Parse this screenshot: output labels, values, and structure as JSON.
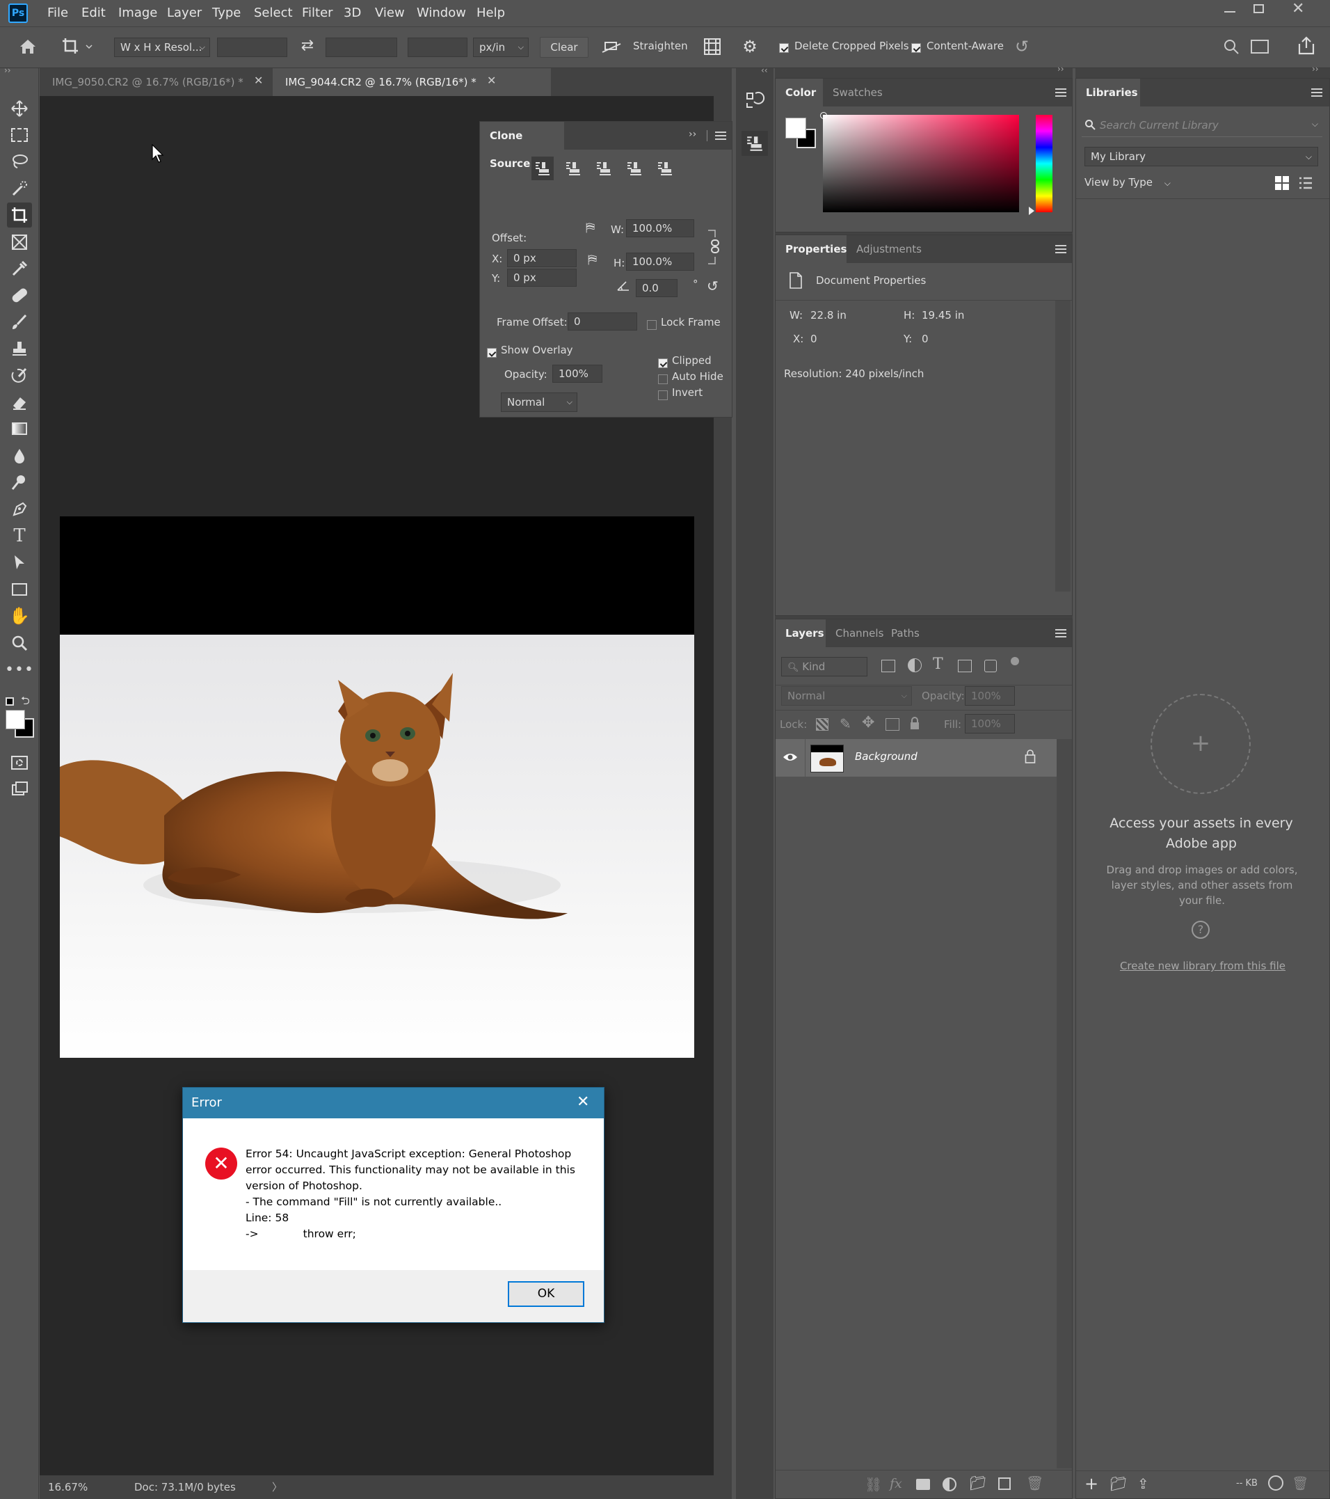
{
  "menu": [
    "File",
    "Edit",
    "Image",
    "Layer",
    "Type",
    "Select",
    "Filter",
    "3D",
    "View",
    "Window",
    "Help"
  ],
  "options": {
    "ratio": "W x H x Resol...",
    "unit": "px/in",
    "clear": "Clear",
    "straighten": "Straighten",
    "delete_cropped": "Delete Cropped Pixels",
    "content_aware": "Content-Aware"
  },
  "tabs": [
    {
      "label": "IMG_9050.CR2 @ 16.7% (RGB/16*) *",
      "active": false
    },
    {
      "label": "IMG_9044.CR2 @ 16.7% (RGB/16*) *",
      "active": true
    }
  ],
  "status": {
    "zoom": "16.67%",
    "doc": "Doc: 73.1M/0 bytes"
  },
  "clone_source": {
    "title": "Clone Source",
    "offset_label": "Offset:",
    "x_label": "X:",
    "x": "0 px",
    "y_label": "Y:",
    "y": "0 px",
    "w_label": "W:",
    "w": "100.0%",
    "h_label": "H:",
    "h": "100.0%",
    "angle": "0.0",
    "frame_offset_label": "Frame Offset:",
    "frame_offset": "0",
    "lock_frame": "Lock Frame",
    "show_overlay": "Show Overlay",
    "opacity_label": "Opacity:",
    "opacity": "100%",
    "blend": "Normal",
    "clipped": "Clipped",
    "auto_hide": "Auto Hide",
    "invert": "Invert"
  },
  "color_panel": {
    "tabs": [
      "Color",
      "Swatches"
    ]
  },
  "properties": {
    "tabs": [
      "Properties",
      "Adjustments"
    ],
    "title": "Document Properties",
    "w_label": "W:",
    "w": "22.8 in",
    "h_label": "H:",
    "h": "19.45 in",
    "x_label": "X:",
    "x": "0",
    "y_label": "Y:",
    "y": "0",
    "resolution": "Resolution: 240 pixels/inch"
  },
  "layers": {
    "tabs": [
      "Layers",
      "Channels",
      "Paths"
    ],
    "kind": "Kind",
    "blend": "Normal",
    "opacity_label": "Opacity:",
    "opacity": "100%",
    "lock_label": "Lock:",
    "fill_label": "Fill:",
    "fill": "100%",
    "layer_name": "Background"
  },
  "libraries": {
    "title": "Libraries",
    "search_placeholder": "Search Current Library",
    "library": "My Library",
    "view_by": "View by Type",
    "headline": "Access your assets in every Adobe app",
    "desc": "Drag and drop images or add colors, layer styles, and other assets from your file.",
    "link": "Create new library from this file",
    "footer_kb": "-- KB"
  },
  "dialog": {
    "title": "Error",
    "lines": [
      "Error 54: Uncaught JavaScript exception: General Photoshop",
      "error occurred. This functionality may not be available in this",
      "version of Photoshop.",
      "- The command \"Fill\" is not currently available..",
      "Line: 58",
      "->             throw err;"
    ],
    "ok": "OK"
  },
  "colors": {
    "accent": "#2e7fab",
    "ok_border": "#0078d7",
    "error_red": "#e81123"
  }
}
